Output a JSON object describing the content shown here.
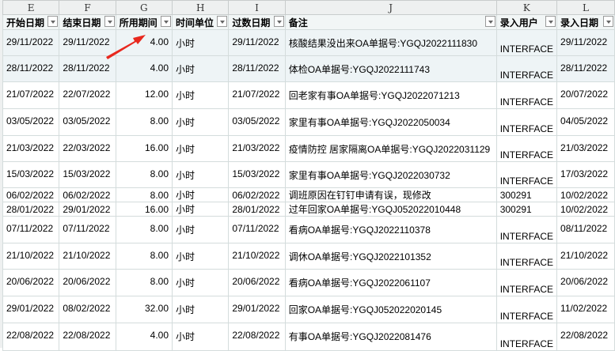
{
  "columns": [
    "E",
    "F",
    "G",
    "H",
    "I",
    "J",
    "K",
    "L"
  ],
  "headers": [
    "开始日期",
    "结束日期",
    "所用期间",
    "时间单位",
    "过数日期",
    "备注",
    "录入用户",
    "录入日期"
  ],
  "rows": [
    [
      "29/11/2022",
      "29/11/2022",
      "4.00",
      "小时",
      "29/11/2022",
      "核酸结果没出来OA单据号:YGQJ2022111830",
      "INTERFACE",
      "29/11/2022"
    ],
    [
      "28/11/2022",
      "28/11/2022",
      "4.00",
      "小时",
      "28/11/2022",
      "体检OA单据号:YGQJ2022111743",
      "INTERFACE",
      "28/11/2022"
    ],
    [
      "21/07/2022",
      "22/07/2022",
      "12.00",
      "小时",
      "21/07/2022",
      "回老家有事OA单据号:YGQJ2022071213",
      "INTERFACE",
      "20/07/2022"
    ],
    [
      "03/05/2022",
      "03/05/2022",
      "8.00",
      "小时",
      "03/05/2022",
      "家里有事OA单据号:YGQJ2022050034",
      "INTERFACE",
      "04/05/2022"
    ],
    [
      "21/03/2022",
      "22/03/2022",
      "16.00",
      "小时",
      "21/03/2022",
      "疫情防控 居家隔离OA单据号:YGQJ2022031129",
      "INTERFACE",
      "21/03/2022"
    ],
    [
      "15/03/2022",
      "15/03/2022",
      "8.00",
      "小时",
      "15/03/2022",
      "家里有事OA单据号:YGQJ2022030732",
      "INTERFACE",
      "17/03/2022"
    ],
    [
      "06/02/2022",
      "06/02/2022",
      "8.00",
      "小时",
      "06/02/2022",
      "调班原因在钉钉申请有误，现修改",
      "300291",
      "10/02/2022"
    ],
    [
      "28/01/2022",
      "29/01/2022",
      "16.00",
      "小时",
      "28/01/2022",
      "过年回家OA单据号:YGQJ052022010448",
      "300291",
      "10/02/2022"
    ],
    [
      "07/11/2022",
      "07/11/2022",
      "8.00",
      "小时",
      "07/11/2022",
      "看病OA单据号:YGQJ2022110378",
      "INTERFACE",
      "08/11/2022"
    ],
    [
      "21/10/2022",
      "21/10/2022",
      "8.00",
      "小时",
      "21/10/2022",
      "调休OA单据号:YGQJ2022101352",
      "INTERFACE",
      "21/10/2022"
    ],
    [
      "20/06/2022",
      "20/06/2022",
      "8.00",
      "小时",
      "20/06/2022",
      "看病OA单据号:YGQJ2022061107",
      "INTERFACE",
      "20/06/2022"
    ],
    [
      "29/01/2022",
      "08/02/2022",
      "32.00",
      "小时",
      "29/01/2022",
      "回家OA单据号:YGQJ052022020145",
      "INTERFACE",
      "11/02/2022"
    ],
    [
      "22/08/2022",
      "22/08/2022",
      "4.00",
      "小时",
      "22/08/2022",
      "有事OA单据号:YGQJ2022081476",
      "INTERFACE",
      "22/08/2022"
    ]
  ],
  "row_heights": [
    33,
    33,
    34,
    34,
    33,
    33,
    17,
    17,
    34,
    33,
    34,
    34,
    35
  ],
  "selected_rows": 2,
  "annotation_color": "#e8281e"
}
